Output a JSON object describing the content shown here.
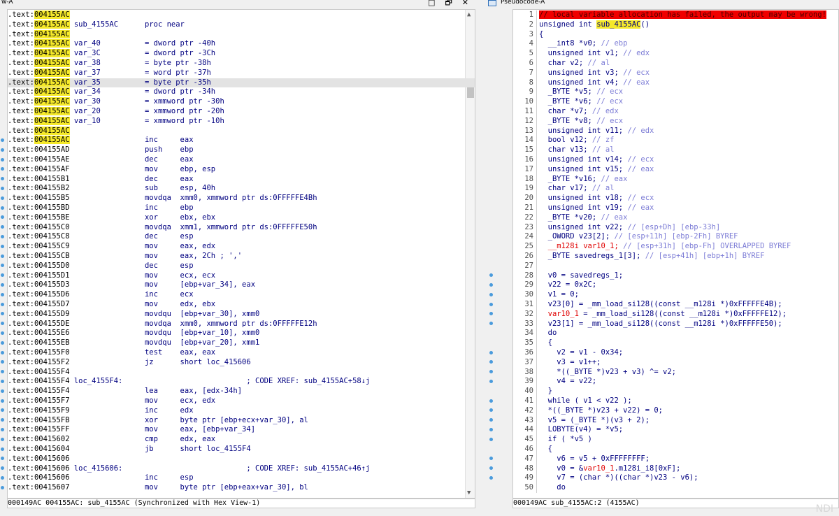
{
  "left_pane": {
    "title": "w-A",
    "window_controls": [
      "□",
      "🗗",
      "✕"
    ],
    "status": "000149AC 004155AC: sub_4155AC (Synchronized with Hex View-1)",
    "lines": [
      {
        "addr": ".text:",
        "addr2": "004155AC",
        "hl_addr": true,
        "text": ""
      },
      {
        "addr": ".text:",
        "addr2": "004155AC",
        "hl_addr": true,
        "text": " sub_4155AC      proc near"
      },
      {
        "addr": ".text:",
        "addr2": "004155AC",
        "hl_addr": true,
        "text": ""
      },
      {
        "addr": ".text:",
        "addr2": "004155AC",
        "hl_addr": true,
        "text": " var_40          = dword ptr -40h"
      },
      {
        "addr": ".text:",
        "addr2": "004155AC",
        "hl_addr": true,
        "text": " var_3C          = dword ptr -3Ch"
      },
      {
        "addr": ".text:",
        "addr2": "004155AC",
        "hl_addr": true,
        "text": " var_38          = byte ptr -38h"
      },
      {
        "addr": ".text:",
        "addr2": "004155AC",
        "hl_addr": true,
        "text": " var_37          = word ptr -37h"
      },
      {
        "addr": ".text:",
        "addr2": "004155AC",
        "hl_addr": true,
        "text": " var_35          = byte ptr -35h",
        "row_hl": true
      },
      {
        "addr": ".text:",
        "addr2": "004155AC",
        "hl_addr": true,
        "text": " var_34          = dword ptr -34h"
      },
      {
        "addr": ".text:",
        "addr2": "004155AC",
        "hl_addr": true,
        "text": " var_30          = xmmword ptr -30h"
      },
      {
        "addr": ".text:",
        "addr2": "004155AC",
        "hl_addr": true,
        "text": " var_20          = xmmword ptr -20h"
      },
      {
        "addr": ".text:",
        "addr2": "004155AC",
        "hl_addr": true,
        "text": " var_10          = xmmword ptr -10h"
      },
      {
        "addr": ".text:",
        "addr2": "004155AC",
        "hl_addr": true,
        "text": ""
      },
      {
        "addr": ".text:",
        "addr2": "004155AC",
        "hl_addr": true,
        "text": "                 inc     eax",
        "dot": true
      },
      {
        "addr": ".text:",
        "addr2": "004155AD",
        "text": "                 push    ebp",
        "dot": true
      },
      {
        "addr": ".text:",
        "addr2": "004155AE",
        "text": "                 dec     eax",
        "dot": true
      },
      {
        "addr": ".text:",
        "addr2": "004155AF",
        "text": "                 mov     ebp, esp",
        "dot": true
      },
      {
        "addr": ".text:",
        "addr2": "004155B1",
        "text": "                 dec     eax",
        "dot": true
      },
      {
        "addr": ".text:",
        "addr2": "004155B2",
        "text": "                 sub     esp, 40h",
        "dot": true
      },
      {
        "addr": ".text:",
        "addr2": "004155B5",
        "text": "                 movdqa  xmm0, xmmword ptr ds:0FFFFFE4Bh",
        "dot": true
      },
      {
        "addr": ".text:",
        "addr2": "004155BD",
        "text": "                 inc     ebp",
        "dot": true
      },
      {
        "addr": ".text:",
        "addr2": "004155BE",
        "text": "                 xor     ebx, ebx",
        "dot": true
      },
      {
        "addr": ".text:",
        "addr2": "004155C0",
        "text": "                 movdqa  xmm1, xmmword ptr ds:0FFFFFE50h",
        "dot": true
      },
      {
        "addr": ".text:",
        "addr2": "004155C8",
        "text": "                 dec     esp",
        "dot": true
      },
      {
        "addr": ".text:",
        "addr2": "004155C9",
        "text": "                 mov     eax, edx",
        "dot": true
      },
      {
        "addr": ".text:",
        "addr2": "004155CB",
        "text": "                 mov     eax, 2Ch ; ','",
        "dot": true
      },
      {
        "addr": ".text:",
        "addr2": "004155D0",
        "text": "                 dec     esp",
        "dot": true
      },
      {
        "addr": ".text:",
        "addr2": "004155D1",
        "text": "                 mov     ecx, ecx",
        "dot": true
      },
      {
        "addr": ".text:",
        "addr2": "004155D3",
        "text": "                 mov     [ebp+var_34], eax",
        "dot": true
      },
      {
        "addr": ".text:",
        "addr2": "004155D6",
        "text": "                 inc     ecx",
        "dot": true
      },
      {
        "addr": ".text:",
        "addr2": "004155D7",
        "text": "                 mov     edx, ebx",
        "dot": true
      },
      {
        "addr": ".text:",
        "addr2": "004155D9",
        "text": "                 movdqu  [ebp+var_30], xmm0",
        "dot": true
      },
      {
        "addr": ".text:",
        "addr2": "004155DE",
        "text": "                 movdqa  xmm0, xmmword ptr ds:0FFFFFE12h",
        "dot": true
      },
      {
        "addr": ".text:",
        "addr2": "004155E6",
        "text": "                 movdqu  [ebp+var_10], xmm0",
        "dot": true
      },
      {
        "addr": ".text:",
        "addr2": "004155EB",
        "text": "                 movdqu  [ebp+var_20], xmm1",
        "dot": true
      },
      {
        "addr": ".text:",
        "addr2": "004155F0",
        "text": "                 test    eax, eax",
        "dot": true
      },
      {
        "addr": ".text:",
        "addr2": "004155F2",
        "text": "                 jz      short loc_415606",
        "dot": true
      },
      {
        "addr": ".text:",
        "addr2": "004155F4",
        "text": "",
        "dot": true
      },
      {
        "addr": ".text:",
        "addr2": "004155F4",
        "text": " loc_4155F4:                            ; CODE XREF: sub_4155AC+58↓j",
        "dot": true
      },
      {
        "addr": ".text:",
        "addr2": "004155F4",
        "text": "                 lea     eax, [edx-34h]",
        "dot": true
      },
      {
        "addr": ".text:",
        "addr2": "004155F7",
        "text": "                 mov     ecx, edx",
        "dot": true
      },
      {
        "addr": ".text:",
        "addr2": "004155F9",
        "text": "                 inc     edx",
        "dot": true
      },
      {
        "addr": ".text:",
        "addr2": "004155FB",
        "text": "                 xor     byte ptr [ebp+ecx+var_30], al",
        "dot": true
      },
      {
        "addr": ".text:",
        "addr2": "004155FF",
        "text": "                 mov     eax, [ebp+var_34]",
        "dot": true
      },
      {
        "addr": ".text:",
        "addr2": "00415602",
        "text": "                 cmp     edx, eax",
        "dot": true
      },
      {
        "addr": ".text:",
        "addr2": "00415604",
        "text": "                 jb      short loc_4155F4",
        "dot": true
      },
      {
        "addr": ".text:",
        "addr2": "00415606",
        "text": "",
        "dot": true
      },
      {
        "addr": ".text:",
        "addr2": "00415606",
        "text": " loc_415606:                            ; CODE XREF: sub_4155AC+46↑j",
        "dot": true
      },
      {
        "addr": ".text:",
        "addr2": "00415606",
        "text": "                 inc     esp",
        "dot": true
      },
      {
        "addr": ".text:",
        "addr2": "00415607",
        "text": "                 mov     byte ptr [ebp+eax+var_30], bl",
        "dot": true
      }
    ]
  },
  "right_pane": {
    "title": "Pseudocode-A",
    "status": "000149AC sub_4155AC:2 (4155AC)",
    "lines": [
      {
        "n": "1",
        "parts": [
          {
            "t": "// local variable allocation has failed, the output may be wrong!",
            "c": "err"
          }
        ]
      },
      {
        "n": "2",
        "parts": [
          {
            "t": "unsigned int ",
            "c": "kw"
          },
          {
            "t": "sub_4155AC",
            "c": "fhl"
          },
          {
            "t": "()",
            "c": ""
          }
        ]
      },
      {
        "n": "3",
        "parts": [
          {
            "t": "{",
            "c": ""
          }
        ]
      },
      {
        "n": "4",
        "parts": [
          {
            "t": "  __int8 *v0; ",
            "c": "kw"
          },
          {
            "t": "// ebp",
            "c": "cm"
          }
        ]
      },
      {
        "n": "5",
        "parts": [
          {
            "t": "  unsigned int v1; ",
            "c": "kw"
          },
          {
            "t": "// edx",
            "c": "cm"
          }
        ]
      },
      {
        "n": "6",
        "parts": [
          {
            "t": "  char v2; ",
            "c": "kw"
          },
          {
            "t": "// al",
            "c": "cm"
          }
        ]
      },
      {
        "n": "7",
        "parts": [
          {
            "t": "  unsigned int v3; ",
            "c": "kw"
          },
          {
            "t": "// ecx",
            "c": "cm"
          }
        ]
      },
      {
        "n": "8",
        "parts": [
          {
            "t": "  unsigned int v4; ",
            "c": "kw"
          },
          {
            "t": "// eax",
            "c": "cm"
          }
        ]
      },
      {
        "n": "9",
        "parts": [
          {
            "t": "  _BYTE *v5; ",
            "c": "kw"
          },
          {
            "t": "// ecx",
            "c": "cm"
          }
        ]
      },
      {
        "n": "10",
        "parts": [
          {
            "t": "  _BYTE *v6; ",
            "c": "kw"
          },
          {
            "t": "// ecx",
            "c": "cm"
          }
        ]
      },
      {
        "n": "11",
        "parts": [
          {
            "t": "  char *v7; ",
            "c": "kw"
          },
          {
            "t": "// edx",
            "c": "cm"
          }
        ]
      },
      {
        "n": "12",
        "parts": [
          {
            "t": "  _BYTE *v8; ",
            "c": "kw"
          },
          {
            "t": "// ecx",
            "c": "cm"
          }
        ]
      },
      {
        "n": "13",
        "parts": [
          {
            "t": "  unsigned int v11; ",
            "c": "kw"
          },
          {
            "t": "// edx",
            "c": "cm"
          }
        ]
      },
      {
        "n": "14",
        "parts": [
          {
            "t": "  bool v12; ",
            "c": "kw"
          },
          {
            "t": "// zf",
            "c": "cm"
          }
        ]
      },
      {
        "n": "15",
        "parts": [
          {
            "t": "  char v13; ",
            "c": "kw"
          },
          {
            "t": "// al",
            "c": "cm"
          }
        ]
      },
      {
        "n": "16",
        "parts": [
          {
            "t": "  unsigned int v14; ",
            "c": "kw"
          },
          {
            "t": "// ecx",
            "c": "cm"
          }
        ]
      },
      {
        "n": "17",
        "parts": [
          {
            "t": "  unsigned int v15; ",
            "c": "kw"
          },
          {
            "t": "// eax",
            "c": "cm"
          }
        ]
      },
      {
        "n": "18",
        "parts": [
          {
            "t": "  _BYTE *v16; ",
            "c": "kw"
          },
          {
            "t": "// eax",
            "c": "cm"
          }
        ]
      },
      {
        "n": "19",
        "parts": [
          {
            "t": "  char v17; ",
            "c": "kw"
          },
          {
            "t": "// al",
            "c": "cm"
          }
        ]
      },
      {
        "n": "20",
        "parts": [
          {
            "t": "  unsigned int v18; ",
            "c": "kw"
          },
          {
            "t": "// ecx",
            "c": "cm"
          }
        ]
      },
      {
        "n": "21",
        "parts": [
          {
            "t": "  unsigned int v19; ",
            "c": "kw"
          },
          {
            "t": "// eax",
            "c": "cm"
          }
        ]
      },
      {
        "n": "22",
        "parts": [
          {
            "t": "  _BYTE *v20; ",
            "c": "kw"
          },
          {
            "t": "// eax",
            "c": "cm"
          }
        ]
      },
      {
        "n": "23",
        "parts": [
          {
            "t": "  unsigned int v22; ",
            "c": "kw"
          },
          {
            "t": "// [esp+Dh] [ebp-33h]",
            "c": "cm"
          }
        ]
      },
      {
        "n": "24",
        "parts": [
          {
            "t": "  _OWORD v23[2]; ",
            "c": "kw"
          },
          {
            "t": "// [esp+11h] [ebp-2Fh] BYREF",
            "c": "cm"
          }
        ]
      },
      {
        "n": "25",
        "parts": [
          {
            "t": "  __m128i var10_1; ",
            "c": "red"
          },
          {
            "t": "// [esp+31h] [ebp-Fh] OVERLAPPED BYREF",
            "c": "cm"
          }
        ]
      },
      {
        "n": "26",
        "parts": [
          {
            "t": "  _BYTE savedregs_1[3]; ",
            "c": "kw"
          },
          {
            "t": "// [esp+41h] [ebp+1h] BYREF",
            "c": "cm"
          }
        ]
      },
      {
        "n": "27",
        "parts": [
          {
            "t": "",
            "c": ""
          }
        ]
      },
      {
        "n": "28",
        "dot": true,
        "parts": [
          {
            "t": "  v0 = savedregs_1;",
            "c": "kw"
          }
        ]
      },
      {
        "n": "29",
        "dot": true,
        "parts": [
          {
            "t": "  v22 = 0x2C;",
            "c": "kw"
          }
        ]
      },
      {
        "n": "30",
        "dot": true,
        "parts": [
          {
            "t": "  v1 = 0;",
            "c": "kw"
          }
        ]
      },
      {
        "n": "31",
        "dot": true,
        "parts": [
          {
            "t": "  v23[0] = _mm_load_si128((const __m128i *)0xFFFFFE4B);",
            "c": "kw"
          }
        ]
      },
      {
        "n": "32",
        "dot": true,
        "parts": [
          {
            "t": "  var10_1",
            "c": "red"
          },
          {
            "t": " = _mm_load_si128((const __m128i *)0xFFFFFE12);",
            "c": "kw"
          }
        ]
      },
      {
        "n": "33",
        "dot": true,
        "parts": [
          {
            "t": "  v23[1] = _mm_load_si128((const __m128i *)0xFFFFFE50);",
            "c": "kw"
          }
        ]
      },
      {
        "n": "34",
        "parts": [
          {
            "t": "  do",
            "c": "kw"
          }
        ]
      },
      {
        "n": "35",
        "parts": [
          {
            "t": "  {",
            "c": "kw"
          }
        ]
      },
      {
        "n": "36",
        "dot": true,
        "parts": [
          {
            "t": "    v2 = v1 - 0x34;",
            "c": "kw"
          }
        ]
      },
      {
        "n": "37",
        "dot": true,
        "parts": [
          {
            "t": "    v3 = v1++;",
            "c": "kw"
          }
        ]
      },
      {
        "n": "38",
        "dot": true,
        "parts": [
          {
            "t": "    *((_BYTE *)v23 + v3) ^= v2;",
            "c": "kw"
          }
        ]
      },
      {
        "n": "39",
        "dot": true,
        "parts": [
          {
            "t": "    v4 = v22;",
            "c": "kw"
          }
        ]
      },
      {
        "n": "40",
        "parts": [
          {
            "t": "  }",
            "c": "kw"
          }
        ]
      },
      {
        "n": "41",
        "dot": true,
        "parts": [
          {
            "t": "  while ( v1 < v22 );",
            "c": "kw"
          }
        ]
      },
      {
        "n": "42",
        "dot": true,
        "parts": [
          {
            "t": "  *((_BYTE *)v23 + v22) = 0;",
            "c": "kw"
          }
        ]
      },
      {
        "n": "43",
        "dot": true,
        "parts": [
          {
            "t": "  v5 = (_BYTE *)(v3 + 2);",
            "c": "kw"
          }
        ]
      },
      {
        "n": "44",
        "dot": true,
        "parts": [
          {
            "t": "  LOBYTE(v4) = *v5;",
            "c": "kw"
          }
        ]
      },
      {
        "n": "45",
        "dot": true,
        "parts": [
          {
            "t": "  if ( *v5 )",
            "c": "kw"
          }
        ]
      },
      {
        "n": "46",
        "parts": [
          {
            "t": "  {",
            "c": "kw"
          }
        ]
      },
      {
        "n": "47",
        "dot": true,
        "parts": [
          {
            "t": "    v6 = v5 + 0xFFFFFFFF;",
            "c": "kw"
          }
        ]
      },
      {
        "n": "48",
        "dot": true,
        "parts": [
          {
            "t": "    v0 = &",
            "c": "kw"
          },
          {
            "t": "var10_1",
            "c": "red"
          },
          {
            "t": ".m128i_i8[0xF];",
            "c": "kw"
          }
        ]
      },
      {
        "n": "49",
        "dot": true,
        "parts": [
          {
            "t": "    v7 = (char *)((char *)v23 - v6);",
            "c": "kw"
          }
        ]
      },
      {
        "n": "50",
        "parts": [
          {
            "t": "    do",
            "c": "kw"
          }
        ]
      }
    ]
  },
  "watermark": "NDI"
}
